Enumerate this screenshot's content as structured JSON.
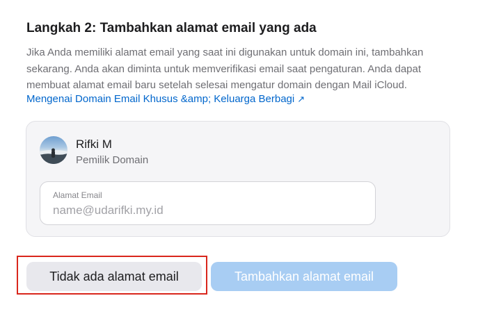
{
  "step": {
    "title": "Langkah 2: Tambahkan alamat email yang ada",
    "description": "Jika Anda memiliki alamat email yang saat ini digunakan untuk domain ini, tambahkan sekarang. Anda akan diminta untuk memverifikasi email saat pengaturan. Anda dapat membuat alamat email baru setelah selesai mengatur domain dengan Mail iCloud.",
    "link_label": "Mengenai Domain Email Khusus &amp; Keluarga Berbagi",
    "link_arrow": "↗"
  },
  "owner": {
    "name": "Rifki M",
    "role": "Pemilik Domain"
  },
  "email_field": {
    "label": "Alamat Email",
    "placeholder": "name@udarifki.my.id",
    "value": ""
  },
  "actions": {
    "no_email_label": "Tidak ada alamat email",
    "add_email_label": "Tambahkan alamat email"
  },
  "colors": {
    "link": "#0066cc",
    "primary_disabled": "#a8cdf3",
    "highlight": "#d9261c"
  }
}
